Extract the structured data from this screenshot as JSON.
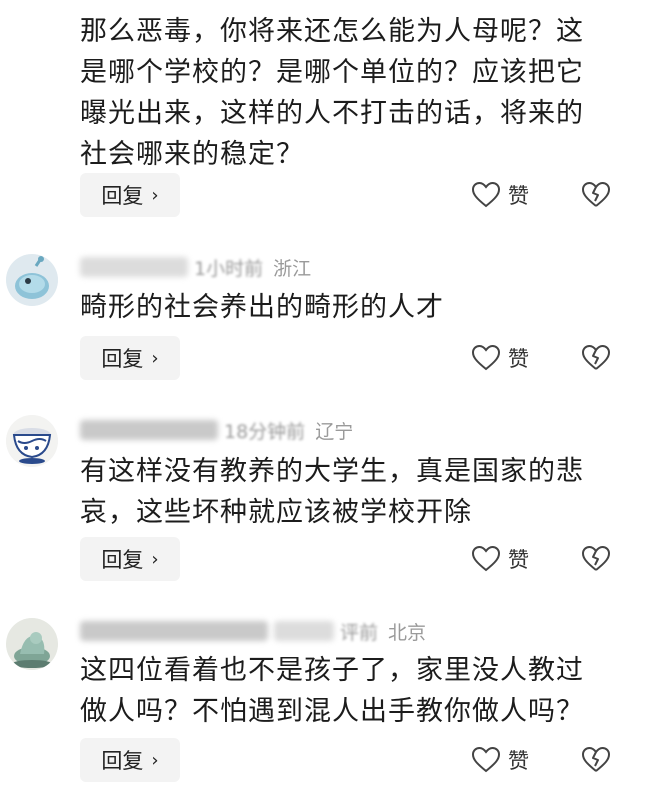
{
  "comments": [
    {
      "text_lines": [
        "那么恶毒，你将来还怎么能为人母呢？这",
        "是哪个学校的？是哪个单位的？应该把它",
        "曝光出来，这样的人不打击的话，将来的",
        "社会哪来的稳定？"
      ],
      "reply_label": "回复",
      "like_label": "赞"
    },
    {
      "time": "1小时前",
      "location": "浙江",
      "text_lines": [
        "畸形的社会养出的畸形的人才"
      ],
      "reply_label": "回复",
      "like_label": "赞"
    },
    {
      "time": "18分钟前",
      "location": "辽宁",
      "text_lines": [
        "有这样没有教养的大学生，真是国家的悲",
        "哀，这些坏种就应该被学校开除"
      ],
      "reply_label": "回复",
      "like_label": "赞"
    },
    {
      "time": "评前",
      "location": "北京",
      "text_lines": [
        "这四位看着也不是孩子了，家里没人教过",
        "做人吗？不怕遇到混人出手教你做人吗？"
      ],
      "reply_label": "回复",
      "like_label": "赞"
    }
  ],
  "icons": {
    "reply_chevron": "chevron-right-icon",
    "like": "heart-outline-icon",
    "dislike": "broken-heart-icon"
  },
  "colors": {
    "text": "#1c1c1c",
    "meta": "#9a9a9a",
    "reply_bg": "#f3f3f3"
  }
}
